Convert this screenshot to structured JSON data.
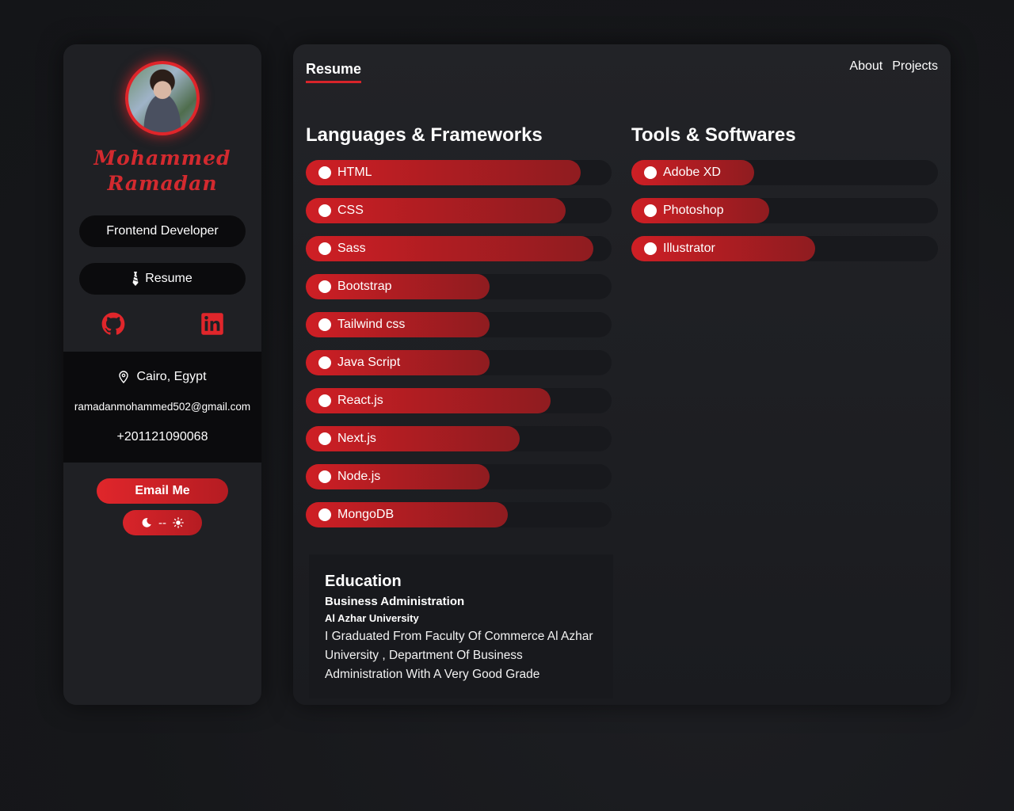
{
  "profile": {
    "name_line1": "Mohammed",
    "name_line2": "Ramadan",
    "role": "Frontend Developer",
    "resume_label": "Resume"
  },
  "social": [
    {
      "icon": "github-icon"
    },
    {
      "icon": "linkedin-icon"
    }
  ],
  "contact": {
    "location": "Cairo, Egypt",
    "email": "ramadanmohammed502@gmail.com",
    "phone": "+201121090068"
  },
  "actions": {
    "email_me": "Email Me",
    "theme_separator": "--"
  },
  "header": {
    "active_tab": "Resume",
    "nav": [
      "About",
      "Projects"
    ]
  },
  "languages": {
    "title": "Languages & Frameworks",
    "items": [
      {
        "label": "HTML",
        "level": 0.9
      },
      {
        "label": "CSS",
        "level": 0.85
      },
      {
        "label": "Sass",
        "level": 0.94
      },
      {
        "label": "Bootstrap",
        "level": 0.6
      },
      {
        "label": "Tailwind css",
        "level": 0.6
      },
      {
        "label": "Java Script",
        "level": 0.6
      },
      {
        "label": "React.js",
        "level": 0.8
      },
      {
        "label": "Next.js",
        "level": 0.7
      },
      {
        "label": "Node.js",
        "level": 0.6
      },
      {
        "label": "MongoDB",
        "level": 0.66
      }
    ]
  },
  "tools": {
    "title": "Tools & Softwares",
    "items": [
      {
        "label": "Adobe XD",
        "level": 0.4
      },
      {
        "label": "Photoshop",
        "level": 0.45
      },
      {
        "label": "Illustrator",
        "level": 0.6
      }
    ]
  },
  "education": {
    "title": "Education",
    "degree": "Business Administration",
    "university": "Al Azhar University",
    "description": "I Graduated From Faculty Of Commerce Al Azhar University , Department Of Business Administration With A Very Good Grade"
  },
  "colors": {
    "accent": "#d8242a",
    "panel": "#1f2024",
    "dark": "#0b0b0d"
  }
}
